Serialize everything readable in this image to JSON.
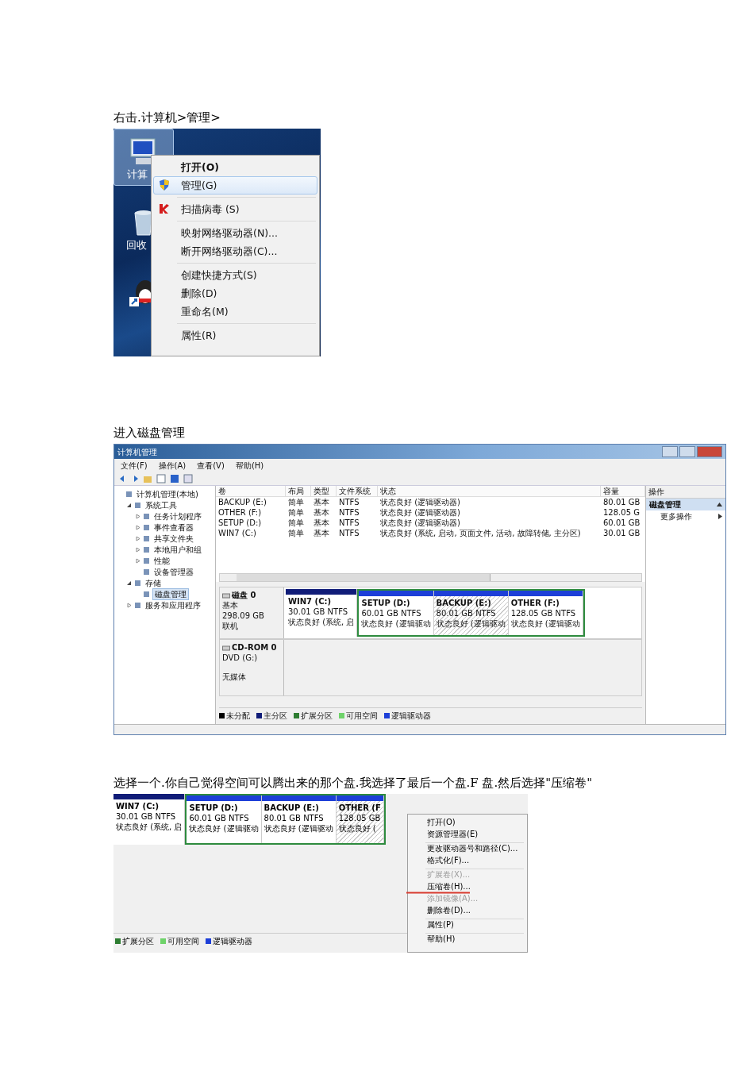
{
  "step1": {
    "caption": "右击.计算机>管理>",
    "desktop_icons": [
      {
        "kind": "computer",
        "label": "计算",
        "selected": true
      },
      {
        "kind": "recycle",
        "label": "回收",
        "selected": false
      },
      {
        "kind": "shortcut",
        "selected": false
      }
    ],
    "menu": [
      [
        {
          "kind": "plain",
          "label": "打开(O)",
          "default": true,
          "selected": false
        },
        {
          "kind": "admin",
          "label": "管理(G)",
          "default": false,
          "selected": true
        }
      ],
      [
        {
          "kind": "scan",
          "label": "扫描病毒 (S)",
          "default": false,
          "selected": false
        }
      ],
      [
        {
          "kind": "plain",
          "label": "映射网络驱动器(N)...",
          "default": false,
          "selected": false
        },
        {
          "kind": "plain",
          "label": "断开网络驱动器(C)...",
          "default": false,
          "selected": false
        }
      ],
      [
        {
          "kind": "plain",
          "label": "创建快捷方式(S)",
          "default": false,
          "selected": false
        },
        {
          "kind": "plain",
          "label": "删除(D)",
          "default": false,
          "selected": false
        },
        {
          "kind": "plain",
          "label": "重命名(M)",
          "default": false,
          "selected": false
        }
      ],
      [
        {
          "kind": "plain",
          "label": "属性(R)",
          "default": false,
          "selected": false
        }
      ]
    ]
  },
  "step2": {
    "caption": "进入磁盘管理",
    "window": {
      "title": "计算机管理",
      "menu": [
        "文件(F)",
        "操作(A)",
        "查看(V)",
        "帮助(H)"
      ],
      "tree": [
        {
          "label": "计算机管理(本地)",
          "selected": false,
          "children": [
            {
              "label": "系统工具",
              "expanded": true,
              "selected": false,
              "children": [
                {
                  "label": "任务计划程序",
                  "expanded": false,
                  "selected": false
                },
                {
                  "label": "事件查看器",
                  "expanded": false,
                  "selected": false
                },
                {
                  "label": "共享文件夹",
                  "expanded": false,
                  "selected": false
                },
                {
                  "label": "本地用户和组",
                  "expanded": false,
                  "selected": false
                },
                {
                  "label": "性能",
                  "expanded": false,
                  "selected": false
                },
                {
                  "label": "设备管理器",
                  "selected": false
                }
              ]
            },
            {
              "label": "存储",
              "expanded": true,
              "selected": false,
              "children": [
                {
                  "label": "磁盘管理",
                  "selected": true
                }
              ]
            },
            {
              "label": "服务和应用程序",
              "expanded": false,
              "selected": false
            }
          ]
        }
      ],
      "table": {
        "columns": [
          "卷",
          "布局",
          "类型",
          "文件系统",
          "状态",
          "容量"
        ],
        "rows": [
          [
            "BACKUP (E:)",
            "简单",
            "基本",
            "NTFS",
            "状态良好 (逻辑驱动器)",
            "80.01 GB"
          ],
          [
            "OTHER (F:)",
            "简单",
            "基本",
            "NTFS",
            "状态良好 (逻辑驱动器)",
            "128.05 G"
          ],
          [
            "SETUP (D:)",
            "简单",
            "基本",
            "NTFS",
            "状态良好 (逻辑驱动器)",
            "60.01 GB"
          ],
          [
            "WIN7 (C:)",
            "简单",
            "基本",
            "NTFS",
            "状态良好 (系统, 启动, 页面文件, 活动, 故障转储, 主分区)",
            "30.01 GB"
          ]
        ]
      },
      "disks": [
        {
          "kind": "disk",
          "name": "磁盘 0",
          "lines": [
            "基本",
            "298.09 GB",
            "联机"
          ],
          "partitions": [
            {
              "kind": "primary",
              "name": "WIN7 (C:)",
              "size": "30.01 GB NTFS",
              "status": "状态良好 (系统, 启",
              "selected": false
            },
            {
              "kind": "logical",
              "name": "SETUP (D:)",
              "size": "60.01 GB NTFS",
              "status": "状态良好 (逻辑驱动",
              "selected": false
            },
            {
              "kind": "logical",
              "name": "BACKUP (E:)",
              "size": "80.01 GB NTFS",
              "status": "状态良好 (逻辑驱动",
              "selected": true
            },
            {
              "kind": "logical",
              "name": "OTHER (F:)",
              "size": "128.05 GB NTFS",
              "status": "状态良好 (逻辑驱动",
              "selected": false
            }
          ]
        },
        {
          "kind": "cdrom",
          "name": "CD-ROM 0",
          "lines": [
            "DVD (G:)",
            "无媒体"
          ]
        }
      ],
      "legend": [
        {
          "label": "未分配",
          "color": "#000000"
        },
        {
          "label": "主分区",
          "color": "#101c78"
        },
        {
          "label": "扩展分区",
          "color": "#2e7d32"
        },
        {
          "label": "可用空间",
          "color": "#6fd36a"
        },
        {
          "label": "逻辑驱动器",
          "color": "#1d3fd8"
        }
      ],
      "actions": {
        "header": "操作",
        "items": [
          {
            "kind": "section",
            "label": "磁盘管理",
            "selected": true
          },
          {
            "kind": "item",
            "label": "更多操作",
            "selected": false
          }
        ]
      }
    }
  },
  "step3": {
    "caption": "选择一个.你自己觉得空间可以腾出来的那个盘.我选择了最后一个盘.F 盘.然后选择\"压缩卷\"",
    "partitions": [
      {
        "kind": "primary",
        "name": "WIN7 (C:)",
        "size": "30.01 GB NTFS",
        "status": "状态良好 (系统, 启",
        "selected": false
      },
      {
        "kind": "logical",
        "name": "SETUP (D:)",
        "size": "60.01 GB NTFS",
        "status": "状态良好 (逻辑驱动",
        "selected": false
      },
      {
        "kind": "logical",
        "name": "BACKUP (E:)",
        "size": "80.01 GB NTFS",
        "status": "状态良好 (逻辑驱动",
        "selected": false
      },
      {
        "kind": "logical",
        "name": "OTHER (F",
        "size": "128.05 GB",
        "status": "状态良好 (",
        "selected": true
      }
    ],
    "legend": [
      {
        "label": "扩展分区",
        "color": "#2e7d32"
      },
      {
        "label": "可用空间",
        "color": "#6fd36a"
      },
      {
        "label": "逻辑驱动器",
        "color": "#1d3fd8"
      }
    ],
    "menu": [
      [
        {
          "label": "打开(O)",
          "disabled": false,
          "underlined": false
        },
        {
          "label": "资源管理器(E)",
          "disabled": false,
          "underlined": false
        }
      ],
      [
        {
          "label": "更改驱动器号和路径(C)...",
          "disabled": false,
          "underlined": false
        },
        {
          "label": "格式化(F)...",
          "disabled": false,
          "underlined": false
        }
      ],
      [
        {
          "label": "扩展卷(X)...",
          "disabled": true,
          "underlined": false
        },
        {
          "label": "压缩卷(H)...",
          "disabled": false,
          "underlined": true
        },
        {
          "label": "添加镜像(A)...",
          "disabled": true,
          "underlined": false
        },
        {
          "label": "删除卷(D)...",
          "disabled": false,
          "underlined": false
        }
      ],
      [
        {
          "label": "属性(P)",
          "disabled": false,
          "underlined": false
        }
      ],
      [
        {
          "label": "帮助(H)",
          "disabled": false,
          "underlined": false
        }
      ]
    ]
  }
}
